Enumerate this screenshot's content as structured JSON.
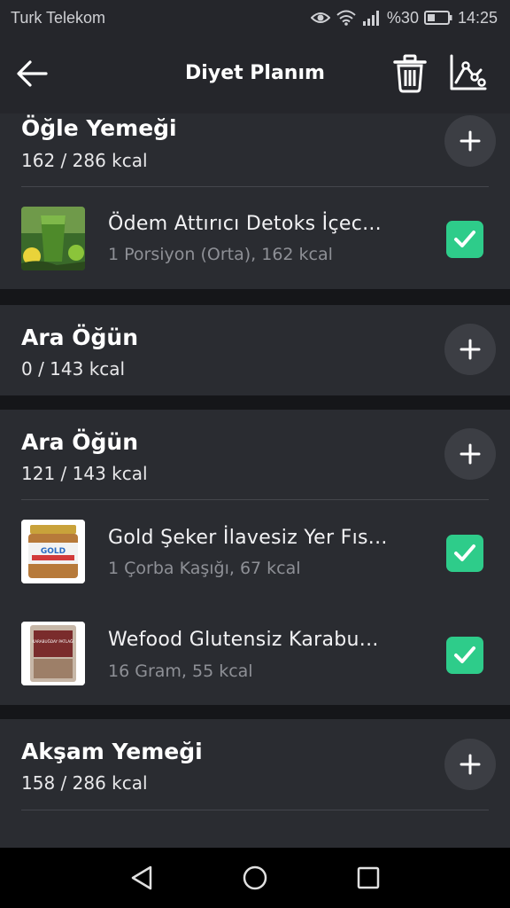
{
  "status_bar": {
    "carrier": "Turk Telekom",
    "battery": "%30",
    "time": "14:25"
  },
  "app_bar": {
    "title": "Diyet Planım",
    "icons": [
      "back-arrow-icon",
      "trash-icon",
      "chart-icon"
    ]
  },
  "sections": [
    {
      "title": "Öğle Yemeği",
      "kcal": "162 / 286 kcal",
      "items": [
        {
          "name": "Ödem Attırıcı Detoks İçec...",
          "detail": "1 Porsiyon (Orta), 162 kcal",
          "checked": true
        }
      ]
    },
    {
      "title": "Ara Öğün",
      "kcal": "0 / 143 kcal",
      "items": []
    },
    {
      "title": "Ara Öğün",
      "kcal": "121 / 143 kcal",
      "items": [
        {
          "name": "Gold Şeker İlavesiz Yer Fıs...",
          "detail": "1 Çorba Kaşığı, 67 kcal",
          "checked": true,
          "thumb_text": "GOLD"
        },
        {
          "name": "Wefood Glutensiz Karabu...",
          "detail": "16 Gram, 55 kcal",
          "checked": true,
          "thumb_text": "KARABUĞDAY PATLAĞI"
        }
      ]
    },
    {
      "title": "Akşam Yemeği",
      "kcal": "158 / 286 kcal",
      "items": []
    }
  ],
  "colors": {
    "background": "#151619",
    "card": "#2a2c31",
    "check": "#2ecc8a",
    "appbar": "#25262b"
  }
}
